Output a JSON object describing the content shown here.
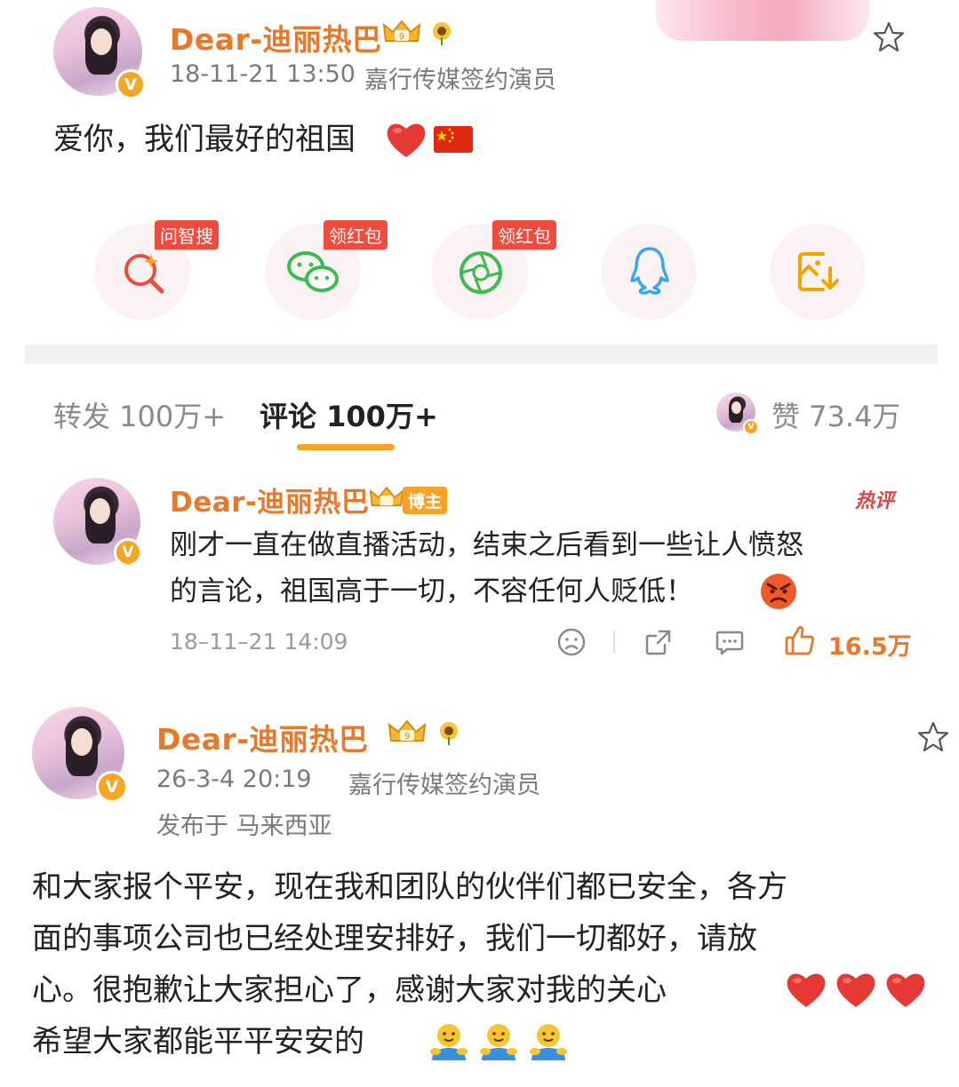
{
  "post1": {
    "username": "Dear-迪丽热巴",
    "time": "18-11-21 13:50",
    "source": "嘉行传媒签约演员",
    "text": "爱你，我们最好的祖国"
  },
  "share": {
    "items": [
      {
        "name": "search",
        "tag": "问智搜"
      },
      {
        "name": "wechat",
        "tag": "领红包"
      },
      {
        "name": "moments",
        "tag": "领红包"
      },
      {
        "name": "qq",
        "tag": ""
      },
      {
        "name": "save-image",
        "tag": ""
      }
    ]
  },
  "tabs": {
    "repost": "转发 100万+",
    "comment": "评论 100万+",
    "like": "赞 73.4万"
  },
  "comment": {
    "username": "Dear-迪丽热巴",
    "role_tag": "博主",
    "hot_label": "热评",
    "line1": "刚才一直在做直播活动，结束之后看到一些让人愤怒",
    "line2": "的言论，祖国高于一切，不容任何人贬低！",
    "time": "18–11–21 14:09",
    "likes": "16.5万"
  },
  "post2": {
    "username": "Dear-迪丽热巴",
    "time": "26-3-4 20:19",
    "source": "嘉行传媒签约演员",
    "location": "发布于 马来西亚",
    "line1": "和大家报个平安，现在我和团队的伙伴们都已安全，各方",
    "line2": "面的事项公司也已经处理安排好，我们一切都好，请放",
    "line3": "心。很抱歉让大家担心了，感谢大家对我的关心",
    "line4": "希望大家都能平平安安的"
  },
  "colors": {
    "accent_orange": "#e8782a",
    "tab_underline": "#f7a125",
    "tag_red": "#ef4b3f",
    "heart_red": "#e53935"
  }
}
